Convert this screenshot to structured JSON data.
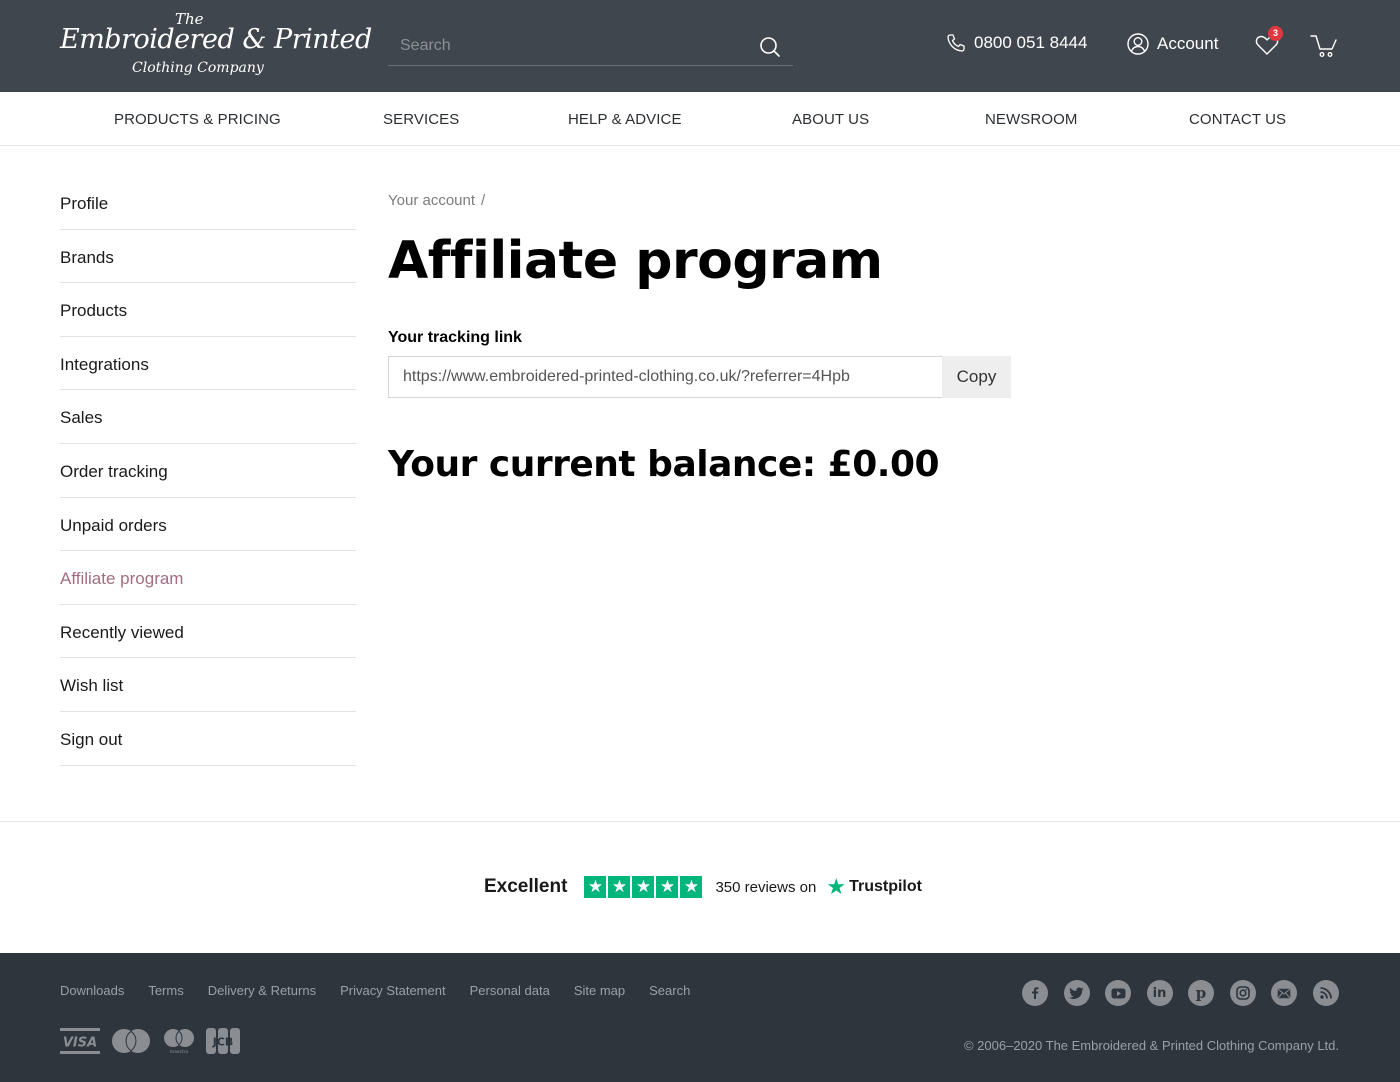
{
  "header": {
    "logo": {
      "line1": "The",
      "line2": "Embroidered & Printed",
      "line3": "Clothing Company"
    },
    "search_placeholder": "Search",
    "phone": "0800 051 8444",
    "account_label": "Account",
    "wishlist_count": "3"
  },
  "nav": {
    "items": [
      {
        "label": "PRODUCTS & PRICING"
      },
      {
        "label": "SERVICES"
      },
      {
        "label": "HELP & ADVICE"
      },
      {
        "label": "ABOUT US"
      },
      {
        "label": "NEWSROOM"
      },
      {
        "label": "CONTACT US"
      }
    ]
  },
  "sidebar": {
    "items": [
      {
        "label": "Profile"
      },
      {
        "label": "Brands"
      },
      {
        "label": "Products"
      },
      {
        "label": "Integrations"
      },
      {
        "label": "Sales"
      },
      {
        "label": "Order tracking"
      },
      {
        "label": "Unpaid orders"
      },
      {
        "label": "Affiliate program",
        "active": true
      },
      {
        "label": "Recently viewed"
      },
      {
        "label": "Wish list"
      },
      {
        "label": "Sign out"
      }
    ],
    "active_color": "#a36d80"
  },
  "main": {
    "breadcrumb": {
      "item": "Your account",
      "separator": "/"
    },
    "title": "Affiliate program",
    "tracking_label": "Your tracking link",
    "tracking_link": "https://www.embroidered-printed-clothing.co.uk/?referrer=4Hpb",
    "copy_label": "Copy",
    "balance": "Your current balance: £0.00"
  },
  "trustpilot": {
    "rating_label": "Excellent",
    "stars": 5,
    "reviews": "350 reviews on",
    "brand": "Trustpilot",
    "color": "#00b67a"
  },
  "footer": {
    "links": [
      {
        "label": "Downloads"
      },
      {
        "label": "Terms"
      },
      {
        "label": "Delivery & Returns"
      },
      {
        "label": "Privacy Statement"
      },
      {
        "label": "Personal data"
      },
      {
        "label": "Site map"
      },
      {
        "label": "Search"
      }
    ],
    "socials": [
      "facebook-icon",
      "twitter-icon",
      "youtube-icon",
      "linkedin-icon",
      "pinterest-icon",
      "instagram-icon",
      "email-icon",
      "rss-icon"
    ],
    "payments": [
      "visa-icon",
      "mastercard-icon",
      "maestro-icon",
      "jcb-icon"
    ],
    "payment_labels": {
      "visa": "VISA",
      "maestro": "maestro",
      "jcb": "JCB"
    },
    "copyright": "© 2006–2020  The Embroidered & Printed Clothing Company Ltd."
  }
}
